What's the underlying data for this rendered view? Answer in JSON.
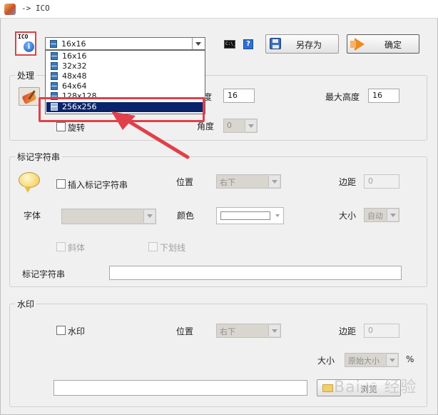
{
  "window": {
    "title": "-> ICO"
  },
  "toolbar": {
    "ico_icon_label": "ICO",
    "size_combo_value": "16x16",
    "cmd_icon_label": "C:\\_",
    "help_icon_label": "?",
    "save_as_label": "另存为",
    "ok_label": "确定"
  },
  "size_dropdown": {
    "options": [
      "16x16",
      "32x32",
      "48x48",
      "64x64",
      "128x128",
      "256x256"
    ],
    "selected_index": 5
  },
  "processing": {
    "legend": "处理",
    "max_width_label": "度",
    "max_width_value": "16",
    "max_height_label": "最大高度",
    "max_height_value": "16",
    "rotate_label": "旋转",
    "angle_label": "角度",
    "angle_value": "0"
  },
  "marker": {
    "legend": "标记字符串",
    "insert_label": "插入标记字符串",
    "position_label": "位置",
    "position_value": "右下",
    "margin_label": "边距",
    "margin_value": "0",
    "font_label": "字体",
    "font_value": "",
    "color_label": "颜色",
    "size_label": "大小",
    "size_value": "自动",
    "italic_label": "斜体",
    "underline_label": "下划线",
    "string_label": "标记字符串",
    "string_value": ""
  },
  "watermark": {
    "legend": "水印",
    "enable_label": "水印",
    "position_label": "位置",
    "position_value": "右下",
    "margin_label": "边距",
    "margin_value": "0",
    "size_label": "大小",
    "size_value": "原始大小",
    "percent_label": "%",
    "path_value": "",
    "browse_label": "浏览"
  },
  "colors": {
    "callout_red": "#e0404a",
    "selection_blue": "#0a246a",
    "accent_orange": "#f08a1c"
  }
}
